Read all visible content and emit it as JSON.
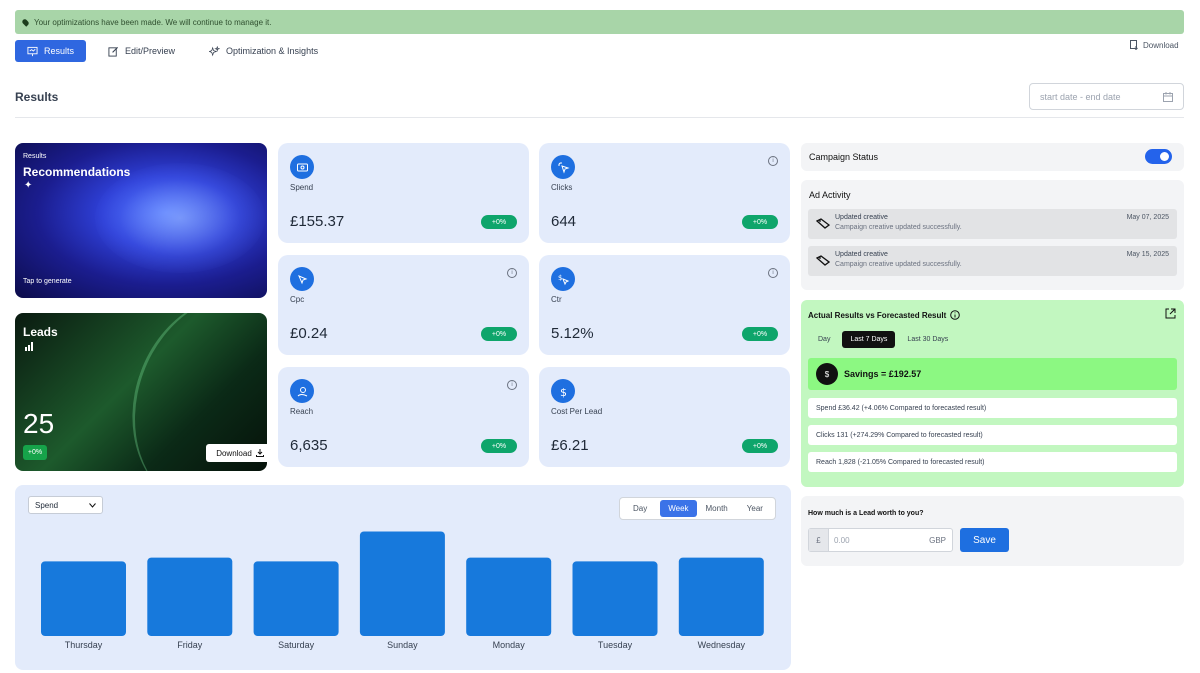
{
  "banner": {
    "text": "Your optimizations have been made. We will continue to manage it."
  },
  "tabs": [
    {
      "label": "Results",
      "active": true
    },
    {
      "label": "Edit/Preview",
      "active": false
    },
    {
      "label": "Optimization & Insights",
      "active": false
    }
  ],
  "download_top": "Download",
  "page_title": "Results",
  "date_range": {
    "placeholder": "start date - end date"
  },
  "recommendations": {
    "small": "Results",
    "title": "Recommendations",
    "cta": "Tap to generate"
  },
  "leads": {
    "title": "Leads",
    "value": "25",
    "change": "+0%",
    "download": "Download"
  },
  "metrics": [
    {
      "label": "Spend",
      "value": "£155.37",
      "change": "+0%",
      "icon": "wallet-icon",
      "info": false
    },
    {
      "label": "Clicks",
      "value": "644",
      "change": "+0%",
      "icon": "cursor-click-icon",
      "info": true
    },
    {
      "label": "Cpc",
      "value": "£0.24",
      "change": "+0%",
      "icon": "cursor-icon",
      "info": true
    },
    {
      "label": "Ctr",
      "value": "5.12%",
      "change": "+0%",
      "icon": "dollar-cursor-icon",
      "info": true
    },
    {
      "label": "Reach",
      "value": "6,635",
      "change": "+0%",
      "icon": "reach-icon",
      "info": true
    },
    {
      "label": "Cost Per Lead",
      "value": "£6.21",
      "change": "+0%",
      "icon": "dollar-icon",
      "info": false
    }
  ],
  "chart_controls": {
    "metric_select": "Spend",
    "ranges": [
      "Day",
      "Week",
      "Month",
      "Year"
    ],
    "active_range": "Week"
  },
  "chart_data": {
    "type": "bar",
    "categories": [
      "Thursday",
      "Friday",
      "Saturday",
      "Sunday",
      "Monday",
      "Tuesday",
      "Wednesday"
    ],
    "values": [
      20,
      21,
      20,
      28,
      21,
      20,
      21
    ],
    "ylim": [
      0,
      30
    ],
    "bar_color": "#1779dc",
    "grid": false
  },
  "campaign_status": {
    "label": "Campaign Status",
    "on": true
  },
  "ad_activity": {
    "title": "Ad Activity",
    "items": [
      {
        "title": "Updated creative",
        "desc": "Campaign creative updated successfully.",
        "date": "May 07, 2025"
      },
      {
        "title": "Updated creative",
        "desc": "Campaign creative updated successfully.",
        "date": "May 15, 2025"
      }
    ]
  },
  "forecast": {
    "title": "Actual Results vs Forecasted Result",
    "tabs": [
      "Day",
      "Last 7 Days",
      "Last 30 Days"
    ],
    "active_tab": "Last 7 Days",
    "savings": "Savings = £192.57",
    "savings_icon": "$",
    "rows": [
      "Spend £36.42 (+4.06% Compared to forecasted result)",
      "Clicks 131  (+274.29% Compared to forecasted result)",
      "Reach 1,828  (-21.05% Compared to forecasted result)"
    ]
  },
  "lead_worth": {
    "question": "How much is a Lead worth to you?",
    "currency": "£",
    "placeholder": "0.00",
    "unit": "GBP",
    "save": "Save"
  }
}
